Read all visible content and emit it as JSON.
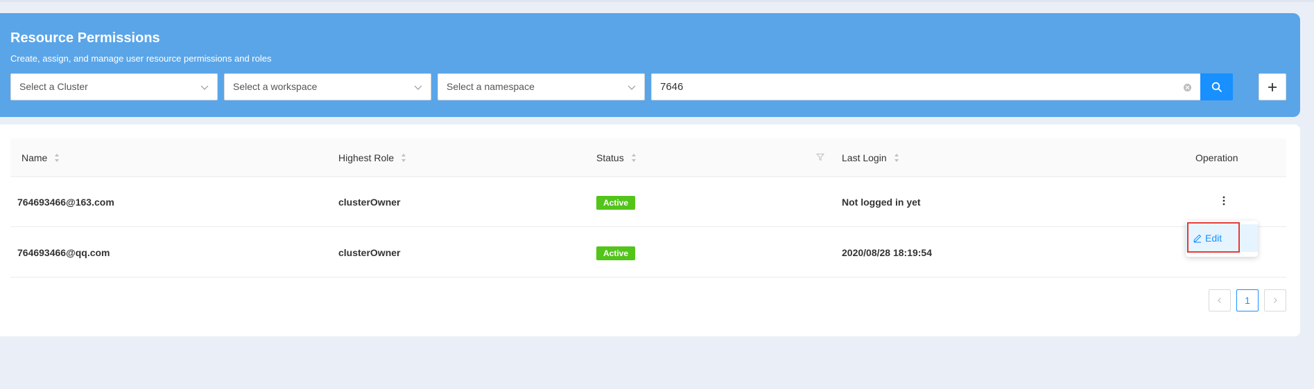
{
  "header": {
    "title": "Resource Permissions",
    "subtitle": "Create, assign, and manage user resource permissions and roles",
    "color": "#5aa5e8"
  },
  "filters": {
    "cluster_placeholder": "Select a Cluster",
    "workspace_placeholder": "Select a workspace",
    "namespace_placeholder": "Select a namespace",
    "search_value": "7646"
  },
  "icons": {
    "select_arrow": "chevron-down-icon",
    "clear": "close-circle-icon",
    "search": "search-icon",
    "add": "plus-icon",
    "sort": "sort-icon",
    "filter": "filter-icon",
    "more": "more-vertical-icon",
    "edit": "edit-icon",
    "prev": "chevron-left-icon",
    "next": "chevron-right-icon"
  },
  "table": {
    "columns": {
      "name": "Name",
      "role": "Highest Role",
      "status": "Status",
      "last_login": "Last Login",
      "operation": "Operation"
    },
    "rows": [
      {
        "name": "764693466@163.com",
        "role": "clusterOwner",
        "status": "Active",
        "last_login": "Not logged in yet"
      },
      {
        "name": "764693466@qq.com",
        "role": "clusterOwner",
        "status": "Active",
        "last_login": "2020/08/28 18:19:54"
      }
    ]
  },
  "pagination": {
    "current_page": "1"
  },
  "dropdown": {
    "edit_label": "Edit"
  },
  "colors": {
    "primary": "#1890ff",
    "active_badge": "#52c41a",
    "highlight": "#e53935"
  }
}
